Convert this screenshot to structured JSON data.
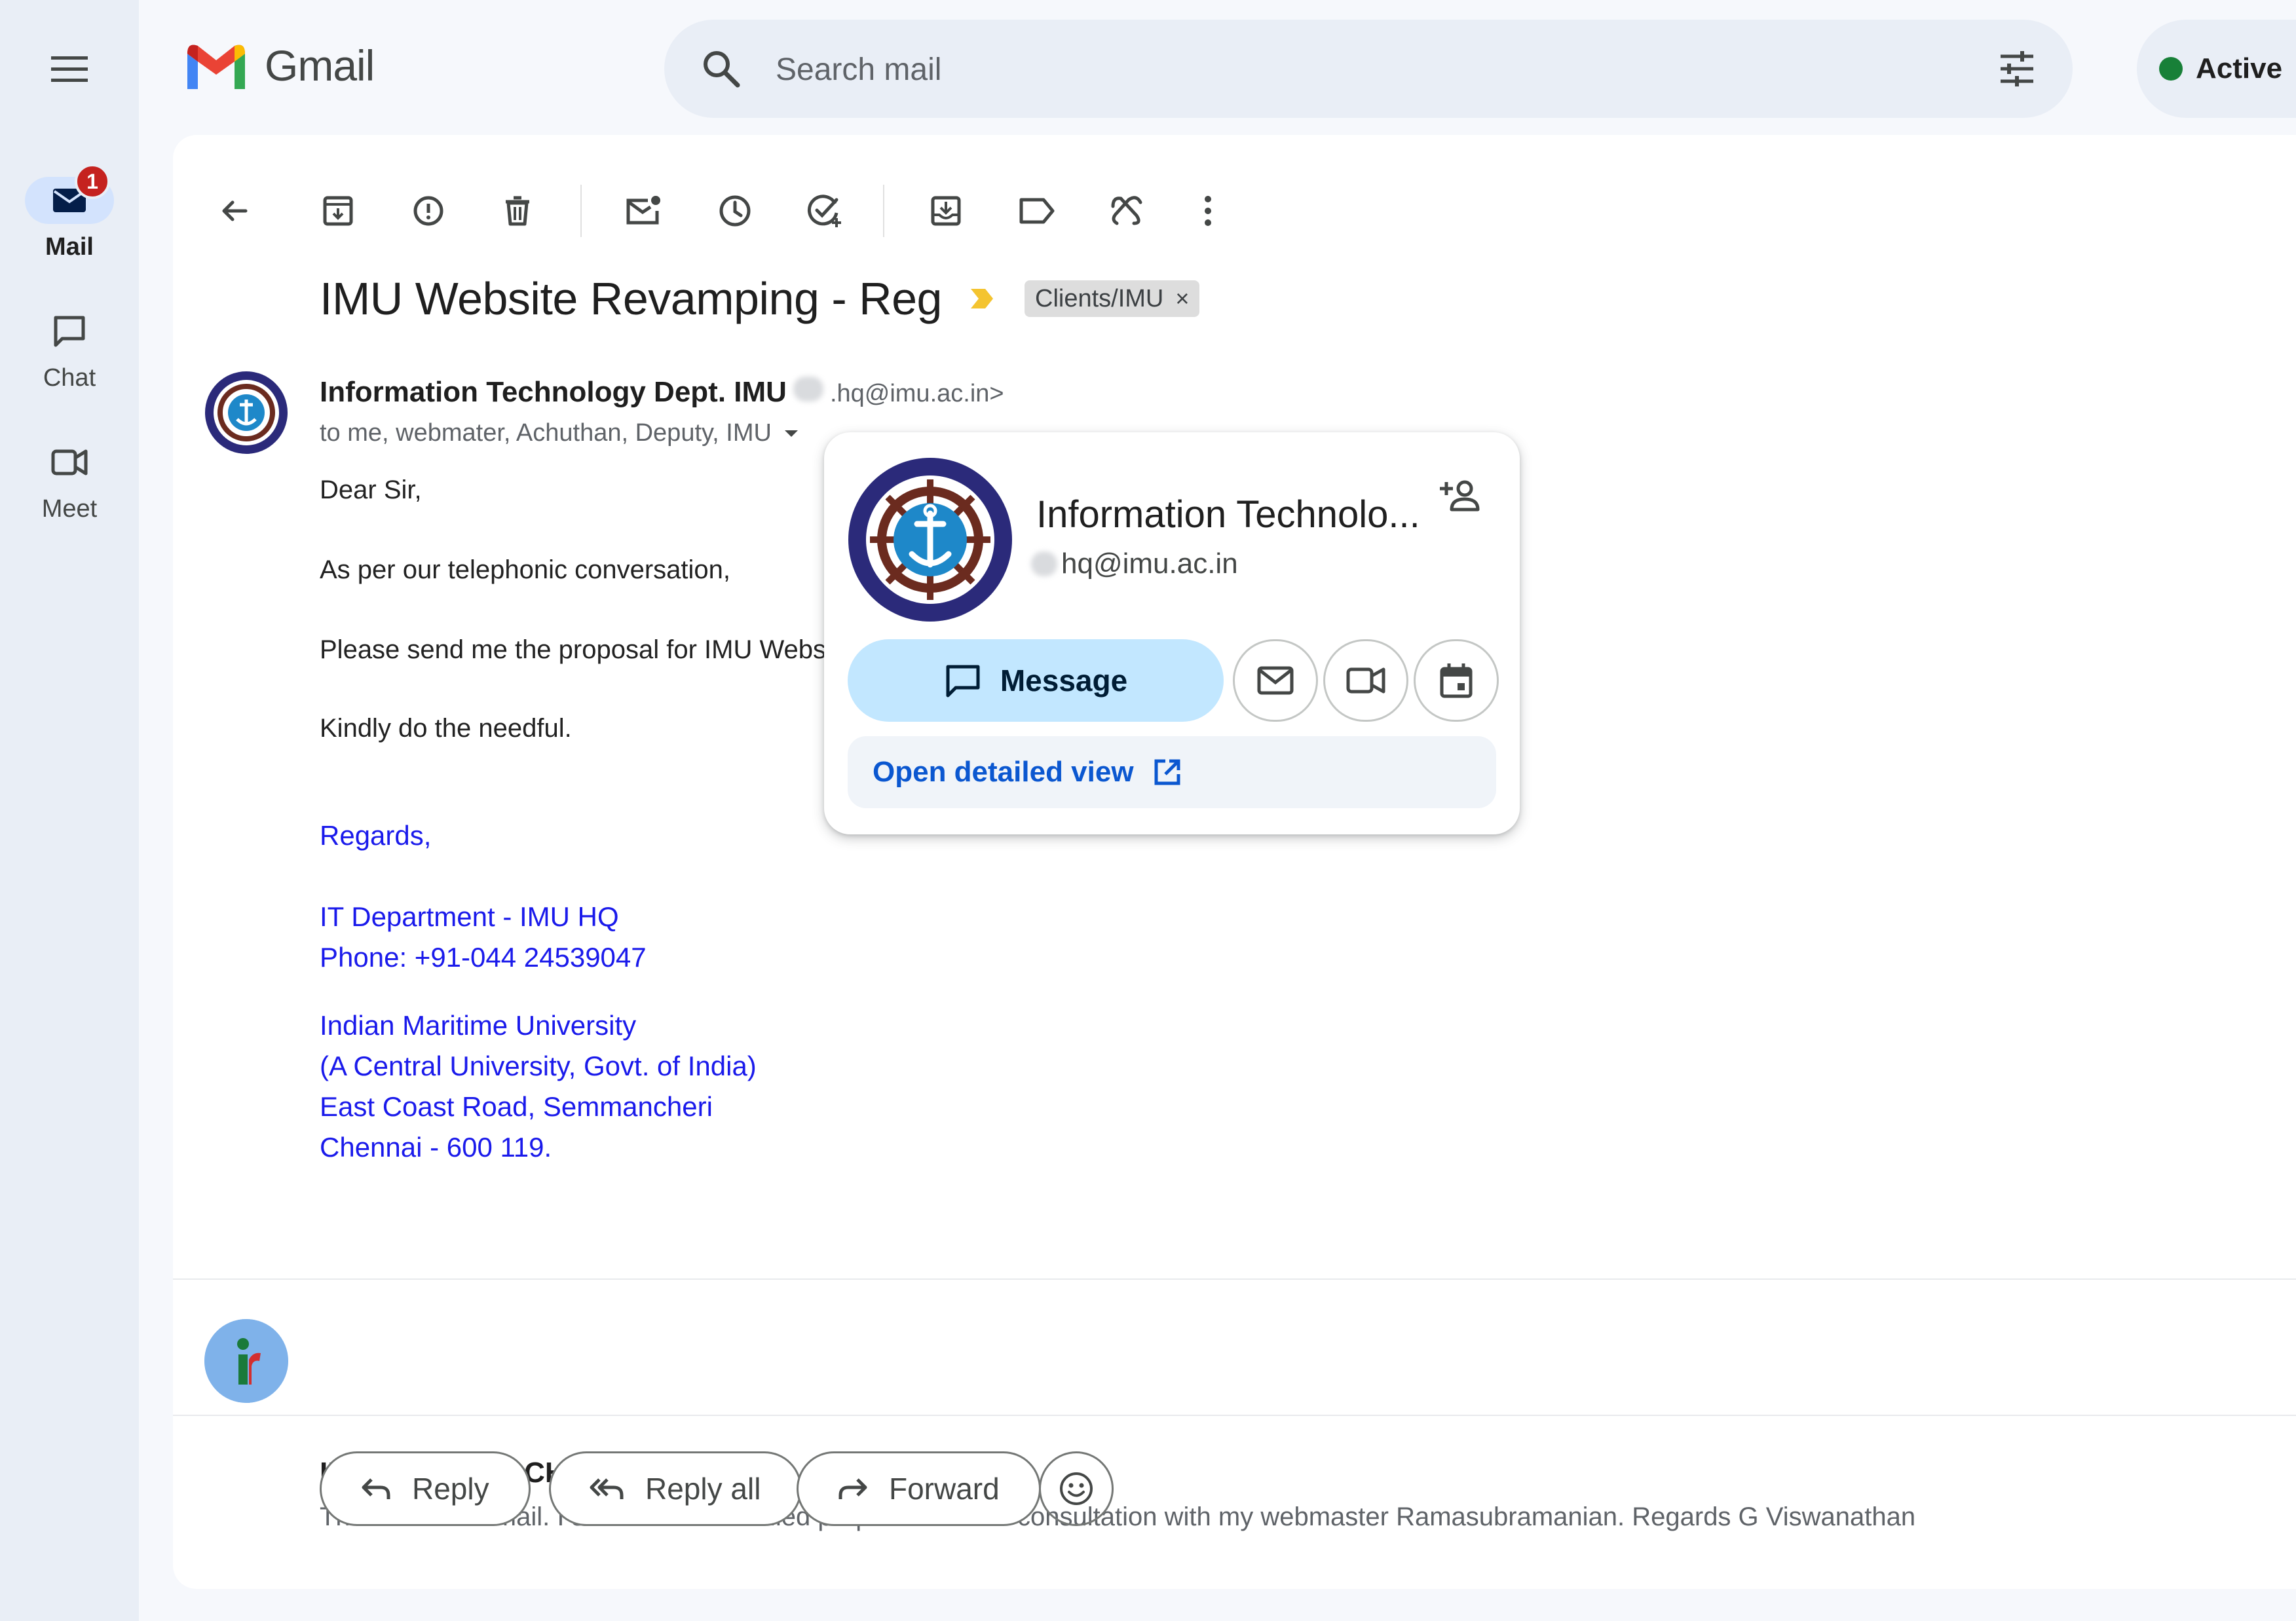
{
  "app": {
    "name": "Gmail"
  },
  "rail": {
    "items": [
      {
        "label": "Mail",
        "badge": "1",
        "icon": "mail-icon",
        "active": true
      },
      {
        "label": "Chat",
        "icon": "chat-icon",
        "active": false
      },
      {
        "label": "Meet",
        "icon": "video-icon",
        "active": false
      }
    ]
  },
  "search": {
    "placeholder": "Search mail"
  },
  "status": {
    "label": "Active",
    "color": "#188038"
  },
  "toolbar": {
    "icons": [
      "back-arrow-icon",
      "archive-icon",
      "report-spam-icon",
      "delete-icon",
      "mark-unread-icon",
      "snooze-icon",
      "add-to-tasks-icon",
      "move-to-icon",
      "label-icon",
      "filter-icon",
      "more-vert-icon"
    ]
  },
  "email": {
    "subject": "IMU Website Revamping - Reg",
    "label_chip": "Clients/IMU",
    "chip_close": "×",
    "sender_name": "Information Technology Dept. IMU",
    "sender_email": ".hq@imu.ac.in>",
    "recipients": "to me, webmater, Achuthan, Deputy, IMU",
    "body": [
      "Dear Sir,",
      "As per our telephonic conversation,",
      "Please send me the proposal for IMU Webs",
      "Kindly do the needful."
    ],
    "signature": [
      "Regards,",
      "IT Department - IMU HQ",
      "Phone: +91-044 24539047",
      "Indian Maritime University",
      "(A Central University, Govt. of India)",
      "East Coast Road, Semmancheri",
      "Chennai - 600 119."
    ],
    "link_color": "#1a1aeb"
  },
  "reply": {
    "sender": "IDEAS TO REACH",
    "snippet": "Thanks for the mail. I shall send a detailed proposal soon in consultation with my webmaster Ramasubramanian. Regards G Viswanathan",
    "avatar_letter": "i"
  },
  "actions": {
    "reply": "Reply",
    "reply_all": "Reply all",
    "forward": "Forward"
  },
  "hovercard": {
    "name": "Information Technolo...",
    "email": "hq@imu.ac.in",
    "message_label": "Message",
    "detail_label": "Open detailed view"
  }
}
